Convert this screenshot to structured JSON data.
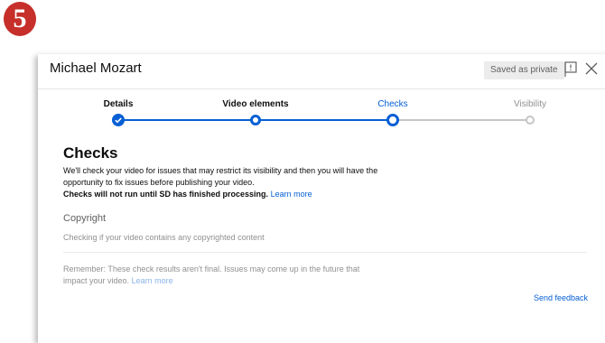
{
  "badge": {
    "number": "5",
    "color": "#c62f2a"
  },
  "header": {
    "title": "Michael Mozart",
    "saved_status": "Saved as private",
    "flag_icon": "feedback-flag-icon",
    "close_icon": "close-icon"
  },
  "stepper": {
    "steps": [
      {
        "label": "Details",
        "state": "completed"
      },
      {
        "label": "Video elements",
        "state": "completed"
      },
      {
        "label": "Checks",
        "state": "current"
      },
      {
        "label": "Visibility",
        "state": "upcoming"
      }
    ],
    "accent_color": "#065fd4",
    "inactive_color": "#c6c6c6"
  },
  "main": {
    "title": "Checks",
    "description_line1": "We'll check your video for issues that may restrict its visibility and then you will have the",
    "description_line2": "opportunity to fix issues before publishing your video.",
    "notice_bold": "Checks will not run until SD has finished processing.",
    "learn_more": "Learn more",
    "copyright": {
      "title": "Copyright",
      "status": "Checking if your video contains any copyrighted content"
    },
    "reminder_line1": "Remember: These check results aren't final. Issues may come up in the future that",
    "reminder_line2": "impact your video.",
    "reminder_learn_more": "Learn more",
    "send_feedback": "Send feedback"
  }
}
